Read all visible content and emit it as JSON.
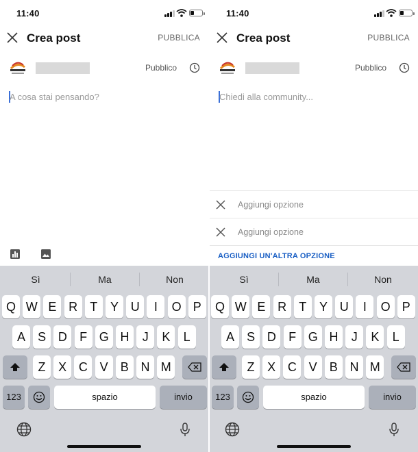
{
  "left_screen": {
    "status": {
      "time": "11:40"
    },
    "header": {
      "title": "Crea post",
      "publish_label": "PUBBLICA"
    },
    "author": {
      "visibility": "Pubblico"
    },
    "composer": {
      "placeholder": "A cosa stai pensando?"
    },
    "tools": [
      "chart-icon",
      "image-icon"
    ]
  },
  "right_screen": {
    "status": {
      "time": "11:40"
    },
    "header": {
      "title": "Crea post",
      "publish_label": "PUBBLICA"
    },
    "author": {
      "visibility": "Pubblico"
    },
    "composer": {
      "placeholder": "Chiedi alla community..."
    },
    "poll": {
      "options": [
        {
          "placeholder": "Aggiungi opzione"
        },
        {
          "placeholder": "Aggiungi opzione"
        }
      ],
      "add_option_label": "AGGIUNGI UN'ALTRA OPZIONE"
    }
  },
  "keyboard": {
    "suggestions": [
      "Sì",
      "Ma",
      "Non"
    ],
    "rows": [
      [
        "Q",
        "W",
        "E",
        "R",
        "T",
        "Y",
        "U",
        "I",
        "O",
        "P"
      ],
      [
        "A",
        "S",
        "D",
        "F",
        "G",
        "H",
        "J",
        "K",
        "L"
      ],
      [
        "Z",
        "X",
        "C",
        "V",
        "B",
        "N",
        "M"
      ]
    ],
    "numbers_key": "123",
    "space_label": "spazio",
    "return_label": "invio"
  }
}
